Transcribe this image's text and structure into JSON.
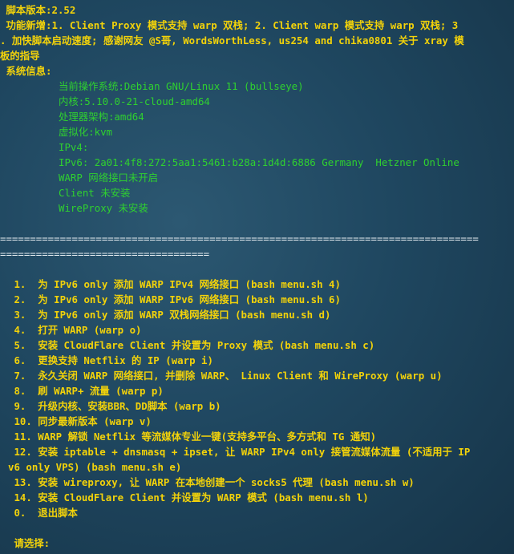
{
  "header": {
    "version_line": " 脚本版本:2.52",
    "features_line1": " 功能新增:1. Client Proxy 模式支持 warp 双栈; 2. Client warp 模式支持 warp 双栈; 3",
    "features_line2": ". 加快脚本启动速度; 感谢网友 @S哥, WordsWorthLess, us254 and chika0801 关于 xray 模",
    "features_line3": "板的指导",
    "sysinfo_label": " 系统信息:"
  },
  "sysinfo": [
    "当前操作系统:Debian GNU/Linux 11 (bullseye)",
    "内核:5.10.0-21-cloud-amd64",
    "处理器架构:amd64",
    "虚拟化:kvm",
    "IPv4:",
    "IPv6: 2a01:4f8:272:5aa1:5461:b28a:1d4d:6886 Germany  Hetzner Online",
    "WARP 网络接口未开启",
    "Client 未安装",
    "WireProxy 未安装"
  ],
  "separator": {
    "line1": "================================================================================",
    "line2": "==================================="
  },
  "menu": [
    " 1.  为 IPv6 only 添加 WARP IPv4 网络接口 (bash menu.sh 4)",
    " 2.  为 IPv6 only 添加 WARP IPv6 网络接口 (bash menu.sh 6)",
    " 3.  为 IPv6 only 添加 WARP 双栈网络接口 (bash menu.sh d)",
    " 4.  打开 WARP (warp o)",
    " 5.  安装 CloudFlare Client 并设置为 Proxy 模式 (bash menu.sh c)",
    " 6.  更换支持 Netflix 的 IP (warp i)",
    " 7.  永久关闭 WARP 网络接口, 并删除 WARP、 Linux Client 和 WireProxy (warp u)",
    " 8.  刷 WARP+ 流量 (warp p)",
    " 9.  升级内核、安装BBR、DD脚本 (warp b)",
    " 10. 同步最新版本 (warp v)",
    " 11. WARP 解锁 Netflix 等流媒体专业一键(支持多平台、多方式和 TG 通知)",
    " 12. 安装 iptable + dnsmasq + ipset, 让 WARP IPv4 only 接管流媒体流量 (不适用于 IP",
    "v6 only VPS) (bash menu.sh e)",
    " 13. 安装 wireproxy, 让 WARP 在本地创建一个 socks5 代理 (bash menu.sh w)",
    " 14. 安装 CloudFlare Client 并设置为 WARP 模式 (bash menu.sh l)",
    " 0.  退出脚本"
  ],
  "prompt": " 请选择:"
}
